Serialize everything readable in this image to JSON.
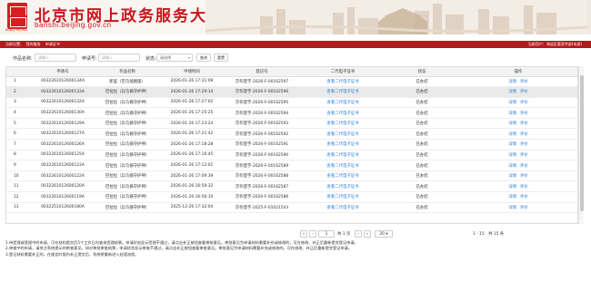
{
  "header": {
    "logo_sub": "Beijing City Hall",
    "title": "北京市网上政务服务大厅",
    "url": "banshi.beijing.gov.cn"
  },
  "nav": {
    "items": [
      "当前位置:",
      "我的服务",
      "申请证书"
    ],
    "user": "当前用户：海淀区委宣传部(本部)"
  },
  "search": {
    "name_label": "作品名称:",
    "name_placeholder": "请输入",
    "apply_label": "申请号:",
    "apply_placeholder": "请输入",
    "status_label": "状态:",
    "status_value": "请选择",
    "query_button": "查询",
    "reset_button": "重置"
  },
  "table": {
    "columns": [
      "",
      "申请号",
      "作品名称",
      "申请时间",
      "登记号",
      "二代电子证书",
      "状态",
      "操作"
    ],
    "rows": [
      {
        "idx": "1",
        "apply_no": "0032261012600134A",
        "name": "新里（巴马插图版）",
        "time": "2026-01-26 17:31:09",
        "reg_no": "京作登字-2026-F-00162597",
        "cert": "查看二代电子证书",
        "status": "已办结",
        "op1": "详情",
        "op2": "评价"
      },
      {
        "idx": "2",
        "apply_no": "0032261012600133A",
        "name": "巴拉拉（兵马俑守护神）",
        "time": "2026-01-26 17:29:14",
        "reg_no": "京作登字-2026-F-00162596",
        "cert": "查看二代电子证书",
        "status": "已办结",
        "op1": "详情",
        "op2": "评价"
      },
      {
        "idx": "3",
        "apply_no": "0032261012600132A",
        "name": "巴拉拉（兵马俑守护神）",
        "time": "2026-01-26 17:27:02",
        "reg_no": "京作登字-2026-F-00162595",
        "cert": "查看二代电子证书",
        "status": "已办结",
        "op1": "详情",
        "op2": "评价"
      },
      {
        "idx": "4",
        "apply_no": "0032261012600130A",
        "name": "巴拉拉（兵马俑守护神）",
        "time": "2026-01-26 17:25:25",
        "reg_no": "京作登字-2026-F-00162594",
        "cert": "查看二代电子证书",
        "status": "已办结",
        "op1": "详情",
        "op2": "评价"
      },
      {
        "idx": "5",
        "apply_no": "0032261012600129A",
        "name": "巴拉拉（兵马俑守护神）",
        "time": "2026-01-26 17:23:24",
        "reg_no": "京作登字-2026-F-00162593",
        "cert": "查看二代电子证书",
        "status": "已办结",
        "op1": "详情",
        "op2": "评价"
      },
      {
        "idx": "6",
        "apply_no": "0032261012600127A",
        "name": "巴拉拉（兵马俑守护神）",
        "time": "2026-01-26 17:21:42",
        "reg_no": "京作登字-2026-F-00162592",
        "cert": "查看二代电子证书",
        "status": "已办结",
        "op1": "详情",
        "op2": "评价"
      },
      {
        "idx": "7",
        "apply_no": "0032261012600126A",
        "name": "巴拉拉（兵马俑守护神）",
        "time": "2026-01-26 17:18:28",
        "reg_no": "京作登字-2026-F-00162591",
        "cert": "查看二代电子证书",
        "status": "已办结",
        "op1": "详情",
        "op2": "评价"
      },
      {
        "idx": "8",
        "apply_no": "0032261012600125A",
        "name": "巴拉拉（兵马俑守护神）",
        "time": "2026-01-26 17:16:45",
        "reg_no": "京作登字-2026-F-00162590",
        "cert": "查看二代电子证书",
        "status": "已办结",
        "op1": "详情",
        "op2": "评价"
      },
      {
        "idx": "9",
        "apply_no": "0032261012600123A",
        "name": "巴拉拉（兵马俑守护神）",
        "time": "2026-01-26 17:13:01",
        "reg_no": "京作登字-2026-F-00162589",
        "cert": "查看二代电子证书",
        "status": "已办结",
        "op1": "详情",
        "op2": "评价"
      },
      {
        "idx": "10",
        "apply_no": "0032261012600122A",
        "name": "巴拉拉（兵马俑守护神）",
        "time": "2026-01-26 17:09:39",
        "reg_no": "京作登字-2026-F-00162588",
        "cert": "查看二代电子证书",
        "status": "已办结",
        "op1": "详情",
        "op2": "评价"
      },
      {
        "idx": "11",
        "apply_no": "0032261012600120A",
        "name": "巴拉拉（兵马俑守护神）",
        "time": "2026-01-26 16:59:32",
        "reg_no": "京作登字-2026-F-00162587",
        "cert": "查看二代电子证书",
        "status": "已办结",
        "op1": "详情",
        "op2": "评价"
      },
      {
        "idx": "12",
        "apply_no": "0032261012600119A",
        "name": "巴拉拉（兵马俑守护神）",
        "time": "2026-01-26 16:56:10",
        "reg_no": "京作登字-2026-F-00162586",
        "cert": "查看二代电子证书",
        "status": "已办结",
        "op1": "详情",
        "op2": "评价"
      },
      {
        "idx": "13",
        "apply_no": "0032251012600180A",
        "name": "巴拉拉（兵马俑守护神）",
        "time": "2025-12-26 17:32:04",
        "reg_no": "京作登字-2025-F-01021543",
        "cert": "查看二代电子证书",
        "status": "已办结",
        "op1": "详情",
        "op2": "评价"
      }
    ]
  },
  "pager": {
    "first": "«",
    "prev": "‹",
    "current_page": "1",
    "total_pages": "共 1 页",
    "next": "›",
    "last": "»",
    "page_size": "20",
    "summary": "1 - 15　共 15 条"
  },
  "notes": [
    "1.待受理或受理中的申请，可在材料提交后5个工作日内查询受理结果。申请状态显示受理不通过，请点击补正按钮查看审核意见。审批意见为申请材料需要补充或修改的，可在修改、补正后重新提交登记申请。",
    "2.审查中的申请，请关注系统提示的审查意见。如对审批审查结果，申请状态显示审查不通过，请点击补正按钮查看审查意见。审批意见为申请材料需要补充或修改的，可在修改、补正后重新提交登记申请。",
    "3.登记材料需要补正的，在规定时限内补正提交后，系统将重新进入处理流程。"
  ],
  "colors": {
    "brand_red": "#c8161d",
    "nav_red": "#b01b1b",
    "link_blue": "#2f7fd8"
  }
}
